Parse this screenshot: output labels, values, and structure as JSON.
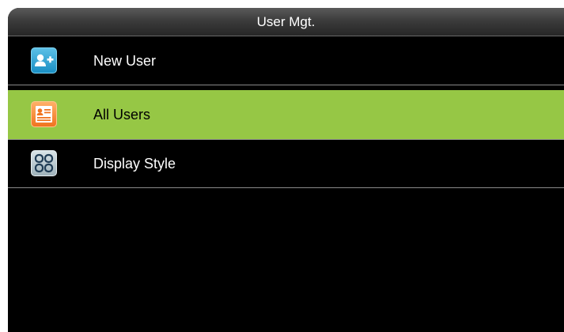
{
  "header": {
    "title": "User Mgt."
  },
  "menu": {
    "items": [
      {
        "label": "New User",
        "icon": "add-user-icon",
        "selected": false
      },
      {
        "label": "All Users",
        "icon": "user-list-icon",
        "selected": true
      },
      {
        "label": "Display Style",
        "icon": "display-style-icon",
        "selected": false
      }
    ]
  },
  "colors": {
    "screen_background": "#000000",
    "selection_highlight": "#96c745",
    "title_text": "#ffffff"
  }
}
